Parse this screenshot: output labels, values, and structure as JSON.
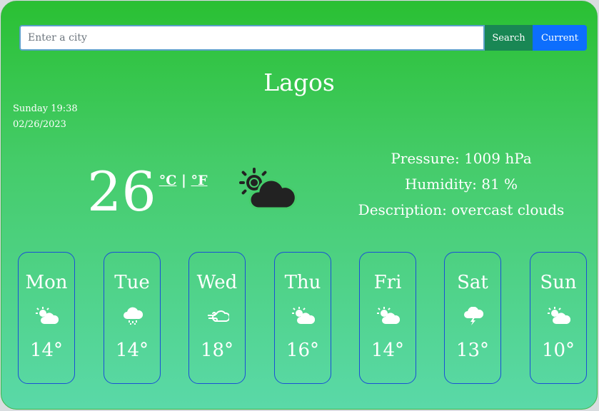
{
  "search": {
    "placeholder": "Enter a city",
    "value": "",
    "search_label": "Search",
    "current_label": "Current"
  },
  "city": "Lagos",
  "datetime": {
    "day_time": "Sunday 19:38",
    "date": "02/26/2023"
  },
  "current": {
    "temperature": "26",
    "unit_c": "°C",
    "unit_sep": "|",
    "unit_f": "°F",
    "icon": "sun-behind-cloud-icon"
  },
  "details": {
    "pressure": "Pressure: 1009 hPa",
    "humidity": "Humidity: 81 %",
    "description": "Description: overcast clouds"
  },
  "colors": {
    "search_button": "#198754",
    "current_button": "#0d6efd",
    "card_border": "#1a4fd6",
    "icon_dark": "#222222"
  },
  "forecast": [
    {
      "day": "Mon",
      "temp": "14°",
      "icon": "sun-cloud-icon"
    },
    {
      "day": "Tue",
      "temp": "14°",
      "icon": "rain-cloud-icon"
    },
    {
      "day": "Wed",
      "temp": "18°",
      "icon": "wind-cloud-icon"
    },
    {
      "day": "Thu",
      "temp": "16°",
      "icon": "sun-cloud-icon"
    },
    {
      "day": "Fri",
      "temp": "14°",
      "icon": "sun-cloud-icon"
    },
    {
      "day": "Sat",
      "temp": "13°",
      "icon": "thunder-cloud-icon"
    },
    {
      "day": "Sun",
      "temp": "10°",
      "icon": "sun-cloud-icon"
    }
  ]
}
